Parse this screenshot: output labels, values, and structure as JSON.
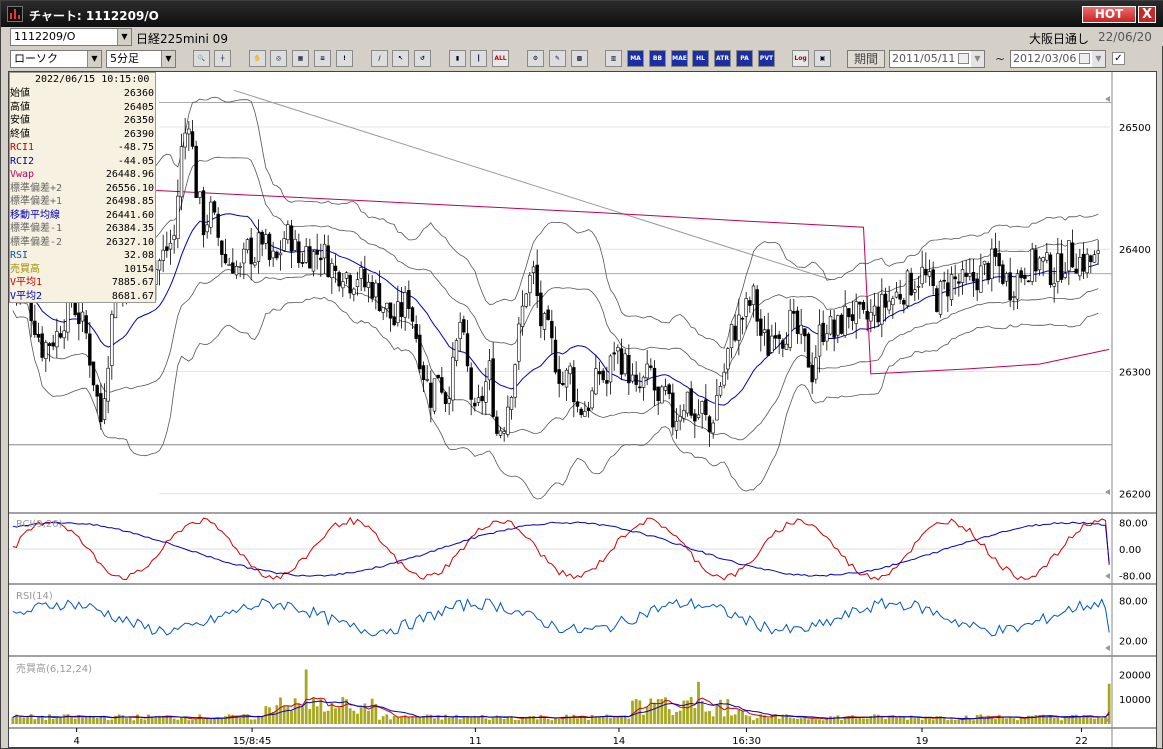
{
  "window": {
    "title": "チャート: 1112209/O",
    "hot_label": "HOT",
    "close_label": "X"
  },
  "header": {
    "code": "1112209/O",
    "instrument": "日経225mini 09",
    "market": "大阪日通し",
    "date": "22/06/20"
  },
  "toolbar": {
    "chart_type": "ローソク",
    "interval": "5分足",
    "buttons": [
      "zoom",
      "fit",
      "drawing",
      "search",
      "table",
      "list",
      "mark",
      "line",
      "cursor",
      "erase",
      "candle",
      "bar",
      "all",
      "trade",
      "tools",
      "grid",
      "rng",
      "MA",
      "BB",
      "MAE",
      "HL",
      "ATR",
      "PARA",
      "PVT",
      "Log",
      "export"
    ],
    "indicator_labels": {
      "ma": "MA",
      "bb": "BB",
      "mae": "MAE",
      "hl": "HL",
      "atr": "ATR",
      "para": "PA RA",
      "pvt": "PVT",
      "log": "Log",
      "all": "ALL"
    },
    "period_label": "期間",
    "date_from": "2011/05/11",
    "date_to": "2012/03/06",
    "tilde": "~"
  },
  "info_panel": {
    "datetime": "2022/06/15  10:15:00",
    "rows": [
      {
        "label": "始値",
        "value": "26360",
        "color": "#000000"
      },
      {
        "label": "高値",
        "value": "26405",
        "color": "#000000"
      },
      {
        "label": "安値",
        "value": "26350",
        "color": "#000000"
      },
      {
        "label": "終値",
        "value": "26390",
        "color": "#000000"
      },
      {
        "label": "RCI1",
        "value": "-48.75",
        "color": "#d00000"
      },
      {
        "label": "RCI2",
        "value": "-44.05",
        "color": "#0000c0"
      },
      {
        "label": "Vwap",
        "value": "26448.96",
        "color": "#c00060"
      },
      {
        "label": "標準偏差+2",
        "value": "26556.10",
        "color": "#666666"
      },
      {
        "label": "標準偏差+1",
        "value": "26498.85",
        "color": "#666666"
      },
      {
        "label": "移動平均線",
        "value": "26441.60",
        "color": "#0000c0"
      },
      {
        "label": "標準偏差-1",
        "value": "26384.35",
        "color": "#666666"
      },
      {
        "label": "標準偏差-2",
        "value": "26327.10",
        "color": "#666666"
      },
      {
        "label": "RSI",
        "value": "32.08",
        "color": "#0055cc"
      },
      {
        "label": "売買高",
        "value": "10154",
        "color": "#a09000"
      },
      {
        "label": "V平均1",
        "value": "7885.67",
        "color": "#d00000"
      },
      {
        "label": "V平均2",
        "value": "8681.67",
        "color": "#0000c0"
      }
    ]
  },
  "panels": {
    "rci_label": "RCI(9,26)",
    "rsi_label": "RSI(14)",
    "vol_label": "売買高(6,12,24)"
  },
  "axes": {
    "price_ticks": [
      "26500",
      "26400",
      "26300",
      "26200"
    ],
    "rci_ticks": [
      "80.00",
      "0.00",
      "-80.00"
    ],
    "rsi_ticks": [
      "80.00",
      "20.00"
    ],
    "vol_ticks": [
      "20000",
      "10000"
    ],
    "x_ticks": [
      "4",
      "15/8:45",
      "11",
      "14",
      "16:30",
      "19",
      "22"
    ]
  },
  "colors": {
    "up": "#ffffff",
    "down": "#000000",
    "ma": "#0000c0",
    "vwap": "#c0005a",
    "band": "#555555",
    "rci1": "#d00000",
    "rci2": "#0000c0",
    "rsi": "#0055cc",
    "vol": "#a8a820"
  },
  "chart_data": {
    "type": "candlestick",
    "y_range": [
      26185,
      26545
    ],
    "price_anchors_x": [
      0,
      4,
      8,
      12,
      16,
      20,
      24,
      28,
      30,
      32,
      34,
      36,
      38,
      40,
      42,
      44,
      46,
      48,
      50,
      52,
      54,
      56,
      58,
      60,
      62,
      64,
      66,
      68,
      70,
      72,
      74,
      76,
      78,
      80,
      82,
      84,
      86,
      88,
      90,
      92,
      94,
      96,
      98,
      100,
      102,
      104,
      106,
      108,
      110,
      112,
      114,
      116,
      118,
      120,
      122,
      124,
      126,
      128,
      130,
      132,
      134,
      136,
      138,
      140,
      142,
      144,
      146,
      148,
      150,
      152,
      154,
      156,
      158,
      160,
      162,
      164,
      166,
      168,
      170,
      172,
      174,
      176,
      178,
      180,
      182,
      184,
      186,
      188,
      190,
      192,
      194,
      196,
      198,
      200,
      202,
      204,
      206,
      208,
      210,
      212,
      214,
      216,
      218,
      220,
      222,
      224,
      226,
      228,
      232,
      236,
      240,
      244,
      248,
      252,
      256,
      260,
      264,
      268,
      272,
      276,
      280,
      284,
      288,
      292,
      296,
      299
    ],
    "price_anchors_y": [
      26370,
      26360,
      26320,
      26330,
      26360,
      26330,
      26260,
      26370,
      26360,
      26420,
      26410,
      26380,
      26380,
      26390,
      26400,
      26410,
      26480,
      26510,
      26450,
      26420,
      26430,
      26410,
      26390,
      26390,
      26380,
      26400,
      26395,
      26410,
      26390,
      26390,
      26410,
      26410,
      26390,
      26400,
      26395,
      26400,
      26390,
      26380,
      26385,
      26375,
      26380,
      26370,
      26370,
      26360,
      26350,
      26340,
      26350,
      26360,
      26330,
      26300,
      26280,
      26300,
      26280,
      26300,
      26340,
      26300,
      26260,
      26280,
      26300,
      26250,
      26260,
      26290,
      26330,
      26370,
      26380,
      26340,
      26330,
      26310,
      26290,
      26300,
      26270,
      26270,
      26280,
      26300,
      26290,
      26320,
      26310,
      26300,
      26280,
      26290,
      26300,
      26270,
      26280,
      26260,
      26270,
      26280,
      26260,
      26270,
      26250,
      26280,
      26300,
      26330,
      26340,
      26350,
      26360,
      26330,
      26320,
      26340,
      26330,
      26340,
      26330,
      26320,
      26300,
      26330,
      26340,
      26330,
      26340,
      26350,
      26340,
      26350,
      26360,
      26370,
      26380,
      26360,
      26375,
      26370,
      26380,
      26390,
      26370,
      26385,
      26390,
      26380,
      26395,
      26390,
      26390
    ],
    "vwap_anchors_x": [
      0,
      40,
      80,
      120,
      160,
      200,
      232,
      234,
      260,
      280,
      299
    ],
    "vwap_anchors_y": [
      26448,
      26448,
      26442,
      26436,
      26430,
      26423,
      26418,
      26298,
      26302,
      26306,
      26318
    ],
    "x_ticks_at_bar": [
      4,
      15,
      29,
      38,
      46,
      57,
      67
    ],
    "sample_values": {
      "last_close": 26390,
      "rci1": -48.75,
      "rci2": -44.05,
      "rsi": 32.08,
      "volume": 10154
    }
  }
}
